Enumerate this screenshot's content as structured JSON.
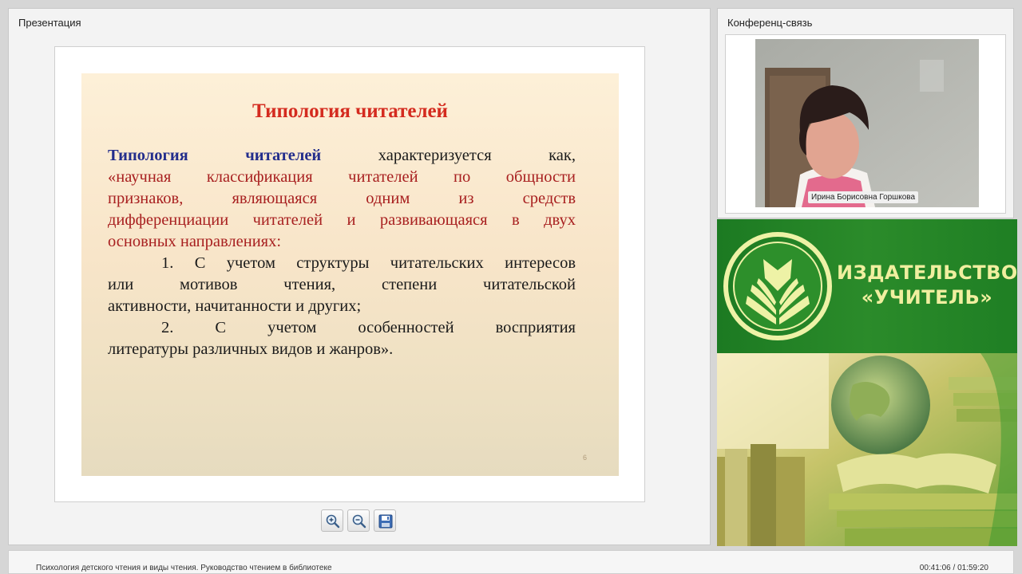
{
  "presentation_panel": {
    "title": "Презентация"
  },
  "conference_panel": {
    "title": "Конференц-связь",
    "speaker_name": "Ирина Борисовна Горшкова"
  },
  "slide": {
    "title": "Типология читателей",
    "term_word1": "Типология",
    "term_word2": "читателей",
    "line1_rest": "характеризуется как,",
    "quote_line1": "«научная классификация читателей по общности",
    "quote_line2": "признаков, являющаяся одним из средств",
    "quote_line3": "дифференциации читателей и развивающаяся в двух",
    "quote_line4": "основных направлениях:",
    "item1_line1": "1. С учетом структуры читательских интересов",
    "item1_line2": "или мотивов чтения, степени читательской",
    "item1_line3": "активности, начитанности и других;",
    "item2_line1": "2. С учетом особенностей восприятия",
    "item2_line2": "литературы различных видов и жанров».",
    "page_number": "6"
  },
  "toolbar": {
    "zoom_in_icon": "zoom-in-icon",
    "zoom_out_icon": "zoom-out-icon",
    "save_icon": "save-icon"
  },
  "banner": {
    "line1": "ИЗДАТЕЛЬСТВО",
    "line2": "«УЧИТЕЛЬ»"
  },
  "bottom_bar": {
    "lecture_title": "Психология детского чтения и виды чтения. Руководство чтением в библиотеке",
    "time_elapsed": "00:41:06",
    "time_separator": " / ",
    "time_total": "01:59:20"
  },
  "colors": {
    "slide_title": "#d42b1f",
    "slide_term": "#232d8c",
    "slide_quote": "#a82020",
    "banner_green": "#2b8b2a",
    "banner_text": "#f0ef9f"
  }
}
